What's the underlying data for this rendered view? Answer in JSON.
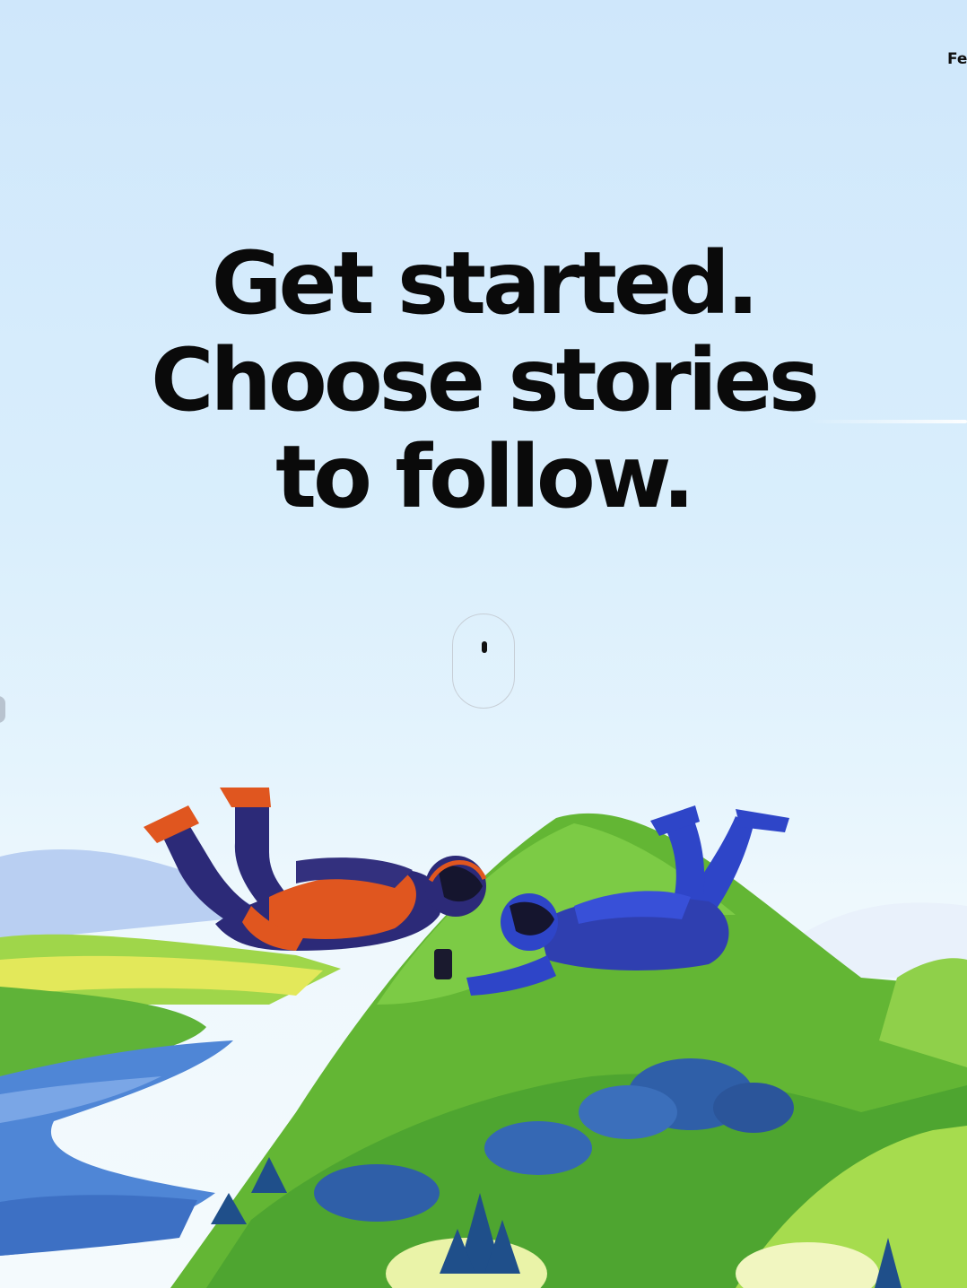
{
  "header": {
    "corner_label": "Fe"
  },
  "hero": {
    "line1": "Get started.",
    "line2": "Choose stories",
    "line3": "to follow."
  },
  "colors": {
    "sky_top": "#cfe7fb",
    "text": "#0a0a0a",
    "hill_green": "#6fbe3a",
    "lake_blue": "#4f86d6",
    "suit_orange": "#e0561f",
    "suit_blue": "#2e45c8"
  },
  "illustration": {
    "name": "skydivers-over-hills",
    "icons": [
      "skydiver-orange-icon",
      "skydiver-blue-icon",
      "phone-icon",
      "hills-icon",
      "lake-icon",
      "trees-icon"
    ]
  },
  "scroll_hint": {
    "icon": "mouse-scroll-icon"
  }
}
